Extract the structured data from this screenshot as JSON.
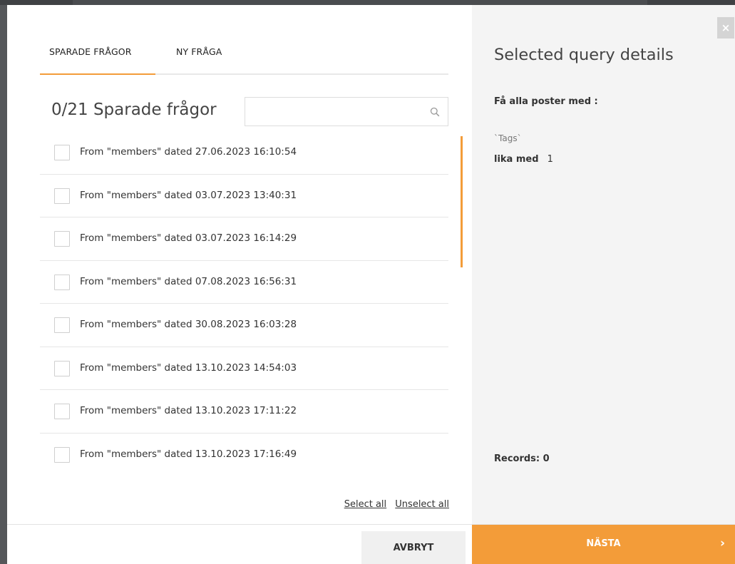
{
  "tabs": {
    "saved": "SPARADE FRÅGOR",
    "new": "NY FRÅGA"
  },
  "list": {
    "title": "0/21 Sparade frågor",
    "search_placeholder": "",
    "items": [
      "From \"members\" dated 27.06.2023 16:10:54",
      "From \"members\" dated 03.07.2023 13:40:31",
      "From \"members\" dated 03.07.2023 16:14:29",
      "From \"members\" dated 07.08.2023 16:56:31",
      "From \"members\" dated 30.08.2023 16:03:28",
      "From \"members\" dated 13.10.2023 14:54:03",
      "From \"members\" dated 13.10.2023 17:11:22",
      "From \"members\" dated 13.10.2023 17:16:49"
    ],
    "select_all": "Select all",
    "unselect_all": "Unselect all"
  },
  "details": {
    "title": "Selected query details",
    "subtitle": "Få alla poster med :",
    "field": "`Tags`",
    "operator": "lika med",
    "value": "1",
    "records": "Records: 0"
  },
  "footer": {
    "cancel": "AVBRYT",
    "next": "NÄSTA",
    "next_arrow": "›"
  },
  "close_label": "×",
  "colors": {
    "accent": "#f39c39",
    "details_bg": "#f4f4f4"
  }
}
